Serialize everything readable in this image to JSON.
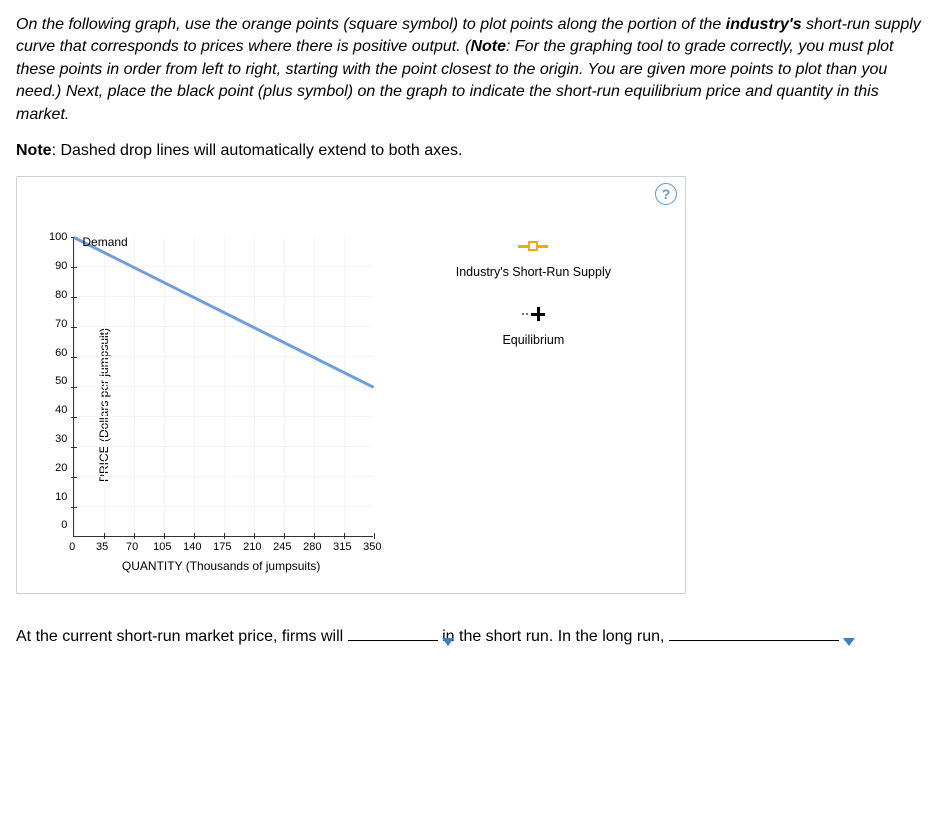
{
  "instructions": {
    "p1a": "On the following graph, use the orange points (square symbol) to plot points along the portion of the ",
    "p1_bold1": "industry's",
    "p1b": " short-run supply curve that corresponds to prices where there is positive output. (",
    "p1_bold2": "Note",
    "p1c": ": For the graphing tool to grade correctly, you must plot these points in order from left to right, starting with the point closest to the origin. You are given more points to plot than you need.) Next, place the black point (plus symbol) on the graph to indicate the short-run equilibrium price and quantity in this market."
  },
  "note": {
    "label": "Note",
    "text": ": Dashed drop lines will automatically extend to both axes."
  },
  "chart_data": {
    "type": "line",
    "title": "",
    "xlabel": "QUANTITY (Thousands of jumpsuits)",
    "ylabel": "PRICE (Dollars per jumpsuit)",
    "xlim": [
      0,
      350
    ],
    "ylim": [
      0,
      100
    ],
    "xticks": [
      0,
      35,
      70,
      105,
      140,
      175,
      210,
      245,
      280,
      315,
      350
    ],
    "yticks": [
      0,
      10,
      20,
      30,
      40,
      50,
      60,
      70,
      80,
      90,
      100
    ],
    "series": [
      {
        "name": "Demand",
        "color": "#6f9fd8",
        "x": [
          0,
          350
        ],
        "y": [
          100,
          50
        ]
      }
    ],
    "tools": [
      {
        "name": "Industry's Short-Run Supply",
        "symbol": "orange-square"
      },
      {
        "name": "Equilibrium",
        "symbol": "black-plus"
      }
    ]
  },
  "legend": {
    "supply": "Industry's Short-Run Supply",
    "equilibrium": "Equilibrium"
  },
  "demand_label": "Demand",
  "help": "?",
  "question": {
    "t1": "At the current short-run market price, firms will ",
    "t2": " in the short run. In the long run, ",
    "t3": "."
  }
}
